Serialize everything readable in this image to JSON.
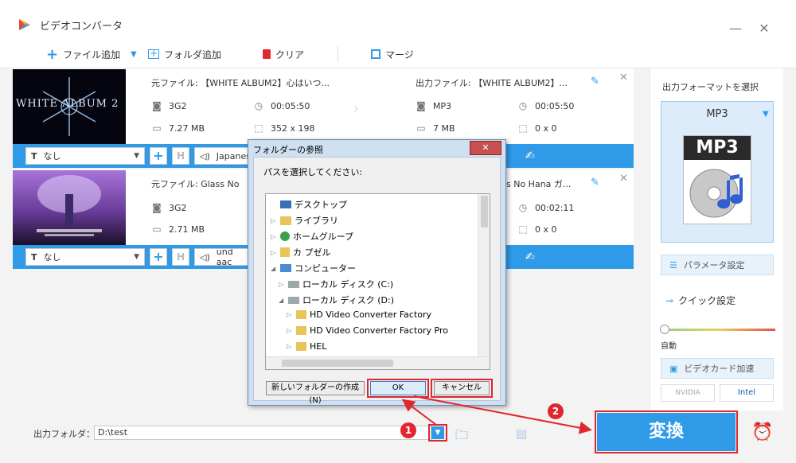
{
  "window": {
    "title": "ビデオコンバータ",
    "minimize": "—",
    "close": "✕"
  },
  "toolbar": {
    "add_file": "ファイル追加",
    "add_folder": "フォルダ追加",
    "clear": "クリア",
    "merge": "マージ"
  },
  "files": [
    {
      "thumb_text": "WHITE ALBUM 2",
      "src_name": "元ファイル: 【WHITE ALBUM2】心はいつ...",
      "src_format": "3G2",
      "src_duration": "00:05:50",
      "src_size": "7.27 MB",
      "src_resolution": "352 x 198",
      "out_name": "出力ファイル: 【WHITE ALBUM2】...",
      "out_format": "MP3",
      "out_duration": "00:05:50",
      "out_size": "7 MB",
      "out_resolution": "0 x 0",
      "subtitle": "なし",
      "audio": "Japanese"
    },
    {
      "src_name": "元ファイル: Glass No",
      "src_format": "3G2",
      "src_size": "2.71 MB",
      "out_name": "s No Hana ガ...",
      "out_duration": "00:02:11",
      "out_resolution": "0 x 0",
      "subtitle": "なし",
      "audio": "und aac"
    }
  ],
  "panel": {
    "title": "出力フォーマットを選択",
    "format": "MP3",
    "format_icon_text": "MP3",
    "param_settings": "パラメータ設定",
    "quick_settings": "クイック設定",
    "auto": "自動",
    "gpu_accel": "ビデオカード加速",
    "nvidia": "NVIDIA",
    "intel": "Intel"
  },
  "bottom": {
    "output_folder_label": "出力フォルダ：",
    "output_folder_value": "D:\\test",
    "convert": "変換"
  },
  "dialog": {
    "title": "フォルダーの参照",
    "prompt": "パスを選択してください:",
    "tree": [
      "デスクトップ",
      "ライブラリ",
      "ホームグループ",
      "カ プゼル",
      "コンピューター",
      "ローカル ディスク (C:)",
      "ローカル ディスク (D:)",
      "HD Video Converter Factory",
      "HD Video Converter Factory Pro",
      "HEL"
    ],
    "new_folder": "新しいフォルダーの作成(N)",
    "ok": "OK",
    "cancel": "キャンセル"
  },
  "annotations": {
    "step1": "1",
    "step2": "2"
  },
  "colors": {
    "accent": "#2f9ae8",
    "highlight": "#e0262e"
  }
}
